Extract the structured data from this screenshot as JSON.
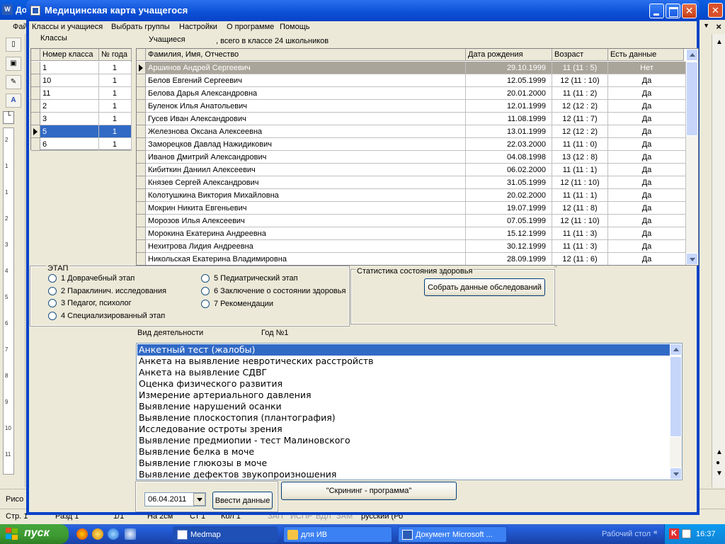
{
  "background_app": {
    "title": "До",
    "menu_file": "Фай",
    "draw_toolbar_label": "Рисо",
    "status_bar": {
      "page": "Стр. 1",
      "section": "Разд 1",
      "pages": "1/1",
      "position": "На 2см",
      "line": "Ст 1",
      "column": "Кол 1",
      "rec": "ЗАП",
      "trk": "ИСПР",
      "ext": "ВДЛ",
      "ovr": "ЗАМ",
      "language": "русский (Ро"
    },
    "ruler_numbers": [
      "2",
      "1",
      "1",
      "2",
      "3",
      "4",
      "5",
      "6",
      "7",
      "8",
      "9",
      "10",
      "11"
    ]
  },
  "window": {
    "title": "Медицинская карта учащегося"
  },
  "menu": [
    "Классы и учащиеся",
    "Выбрать группы",
    "Настройки",
    "О программе",
    "Помощь"
  ],
  "classes": {
    "label": "Классы",
    "columns": [
      "Номер класса",
      "№ года"
    ],
    "rows": [
      {
        "number": "1",
        "year": "1"
      },
      {
        "number": "10",
        "year": "1"
      },
      {
        "number": "11",
        "year": "1"
      },
      {
        "number": "2",
        "year": "1"
      },
      {
        "number": "3",
        "year": "1"
      },
      {
        "number": "5",
        "year": "1"
      },
      {
        "number": "6",
        "year": "1"
      }
    ],
    "selected_index": 5
  },
  "students": {
    "label": "Учащиеся",
    "summary": ", всего в классе 24 школьников",
    "columns": [
      "Фамилия, Имя, Отчество",
      "Дата рождения",
      "Возраст",
      "Есть данные"
    ],
    "rows": [
      {
        "name": "Аршинов Андрей Сергеевич",
        "dob": "29.10.1999",
        "age": "11 (11 : 5)",
        "has_data": "Нет"
      },
      {
        "name": "Белов Евгений Сергеевич",
        "dob": "12.05.1999",
        "age": "12 (11 : 10)",
        "has_data": "Да"
      },
      {
        "name": "Белова Дарья Александровна",
        "dob": "20.01.2000",
        "age": "11 (11 : 2)",
        "has_data": "Да"
      },
      {
        "name": "Буленок Илья  Анатольевич",
        "dob": "12.01.1999",
        "age": "12 (12 : 2)",
        "has_data": "Да"
      },
      {
        "name": "Гусев Иван Александрович",
        "dob": "11.08.1999",
        "age": "12 (11 : 7)",
        "has_data": "Да"
      },
      {
        "name": "Железнова Оксана Алексеевна",
        "dob": "13.01.1999",
        "age": "12 (12 : 2)",
        "has_data": "Да"
      },
      {
        "name": "Заморецков Давлад Нажидикович",
        "dob": "22.03.2000",
        "age": "11 (11 : 0)",
        "has_data": "Да"
      },
      {
        "name": "Иванов Дмитрий Александрович",
        "dob": "04.08.1998",
        "age": "13 (12 : 8)",
        "has_data": "Да"
      },
      {
        "name": "Кибиткин Даниил Алексеевич",
        "dob": "06.02.2000",
        "age": "11 (11 : 1)",
        "has_data": "Да"
      },
      {
        "name": "Князев Сергей Александрович",
        "dob": "31.05.1999",
        "age": "12 (11 : 10)",
        "has_data": "Да"
      },
      {
        "name": "Колотушкина Виктория Михайловна",
        "dob": "20.02.2000",
        "age": "11 (11 : 1)",
        "has_data": "Да"
      },
      {
        "name": "Мокрин Никита Евгеньевич",
        "dob": "19.07.1999",
        "age": "12 (11 : 8)",
        "has_data": "Да"
      },
      {
        "name": "Морозов Илья Алексеевич",
        "dob": "07.05.1999",
        "age": "12 (11 : 10)",
        "has_data": "Да"
      },
      {
        "name": "Морокина Екатерина Андреевна",
        "dob": "15.12.1999",
        "age": "11 (11 : 3)",
        "has_data": "Да"
      },
      {
        "name": "Нехитрова Лидия Андреевна",
        "dob": "30.12.1999",
        "age": "11 (11 : 3)",
        "has_data": "Да"
      },
      {
        "name": "Никольская Екатерина Владимировна",
        "dob": "28.09.1999",
        "age": "12 (11 : 6)",
        "has_data": "Да"
      }
    ],
    "selected_index": 0
  },
  "stage": {
    "label": "ЭТАП",
    "options": [
      "1 Доврачебный этап",
      "2 Параклинич. исследования",
      "3 Педагог, психолог",
      "4 Специализированный этап",
      "5 Педиатрический этап",
      "6 Заключение о состоянии здоровья",
      "7 Рекомендации"
    ]
  },
  "stats": {
    "label": "Статистика состояния здоровья",
    "collect_button": "Собрать данные обследований"
  },
  "activity": {
    "label": "Вид деятельности",
    "year_label": "Год №1",
    "items": [
      "Анкетный тест (жалобы)",
      "Анкета на выявление невротических расстройств",
      "Анкета на выявление СДВГ",
      "Оценка физического развития",
      "Измерение артериального давления",
      "Выявление нарушений осанки",
      "Выявление плоскостопия (плантография)",
      "Исследование остроты зрения",
      "Выявление предмиопии - тест Малиновского",
      "Выявление белка в моче",
      "Выявление глюкозы в моче",
      "Выявление дефектов звукопроизношения"
    ],
    "selected_index": 0
  },
  "bottom": {
    "date_value": "06.04.2011",
    "enter_button": "Ввести данные",
    "screening_button": "\"Скрининг - программа\""
  },
  "taskbar": {
    "start_label": "пуск",
    "tasks": [
      {
        "label": "Medmap",
        "active": true
      },
      {
        "label": "для ИВ",
        "active": false
      },
      {
        "label": "Документ Microsoft ...",
        "active": false
      }
    ],
    "desktop_label": "Рабочий стол",
    "clock": "16:37"
  },
  "colors": {
    "title_bar": "#0842c8",
    "selection": "#316ac5",
    "selected_row": "#a9a59a",
    "taskbar": "#245edb",
    "start_button": "#3d9a32"
  }
}
